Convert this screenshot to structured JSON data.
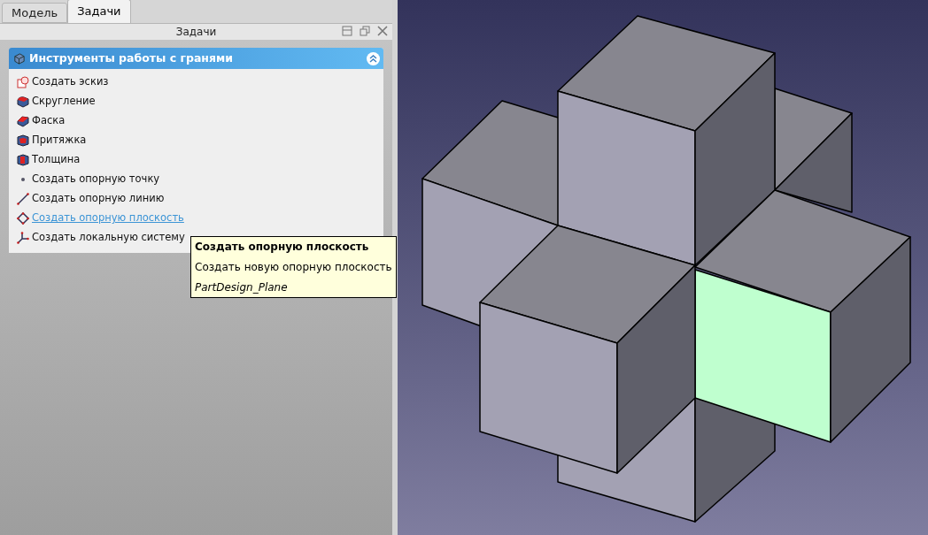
{
  "tabs": [
    {
      "label": "Модель",
      "selected": false
    },
    {
      "label": "Задачи",
      "selected": true
    }
  ],
  "pane_title": "Задачи",
  "task_panel": {
    "title": "Инструменты работы с гранями",
    "expanded": true,
    "items": [
      {
        "kind": "sketch",
        "label": "Создать эскиз",
        "hovered": false
      },
      {
        "kind": "fillet",
        "label": "Скругление",
        "hovered": false
      },
      {
        "kind": "chamfer",
        "label": "Фаска",
        "hovered": false
      },
      {
        "kind": "draft",
        "label": "Притяжка",
        "hovered": false
      },
      {
        "kind": "thickness",
        "label": "Толщина",
        "hovered": false
      },
      {
        "kind": "point",
        "label": "Создать опорную точку",
        "hovered": false
      },
      {
        "kind": "line",
        "label": "Создать опорную линию",
        "hovered": false
      },
      {
        "kind": "plane",
        "label": "Создать опорную плоскость",
        "hovered": true
      },
      {
        "kind": "lcs",
        "label": "Создать локальную систему",
        "hovered": false
      }
    ]
  },
  "tooltip": {
    "title": "Создать опорную плоскость",
    "description": "Создать новую опорную плоскость",
    "command": "PartDesign_Plane"
  }
}
